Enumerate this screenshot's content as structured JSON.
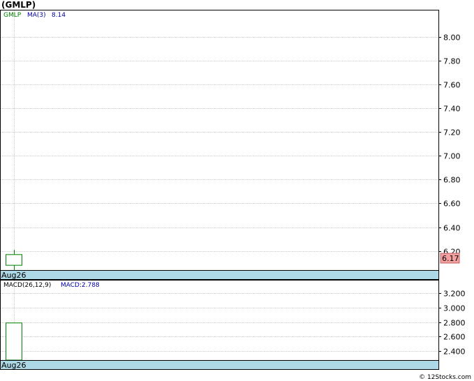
{
  "title": "(GMLP)",
  "price_legend": {
    "symbol": "GMLP",
    "ma_label": "MA(3)",
    "ma_value": "8.14"
  },
  "macd_legend": {
    "label": "MACD(26,12,9)",
    "value_label": "MACD:2.788"
  },
  "current_price_label": "6.17",
  "watermark": "© 12Stocks.com",
  "colors": {
    "symbol_text": "#008000",
    "ma_text": "#0000aa",
    "macd_value_text": "#0000aa",
    "date_band": "#add8e6",
    "candle_border": "#008000",
    "price_tag_bg": "#f4a0a0",
    "grid": "#c8c8c8"
  },
  "chart_data": [
    {
      "type": "candlestick",
      "panel": "price",
      "x": [
        "Aug26"
      ],
      "x_tick_labels": [
        "Aug26"
      ],
      "open": [
        6.08
      ],
      "close": [
        6.17
      ],
      "high": [
        6.21
      ],
      "low": [
        6.04
      ],
      "ylim": [
        6.04,
        8.22
      ],
      "y_ticks": [
        6.2,
        6.4,
        6.6,
        6.8,
        7.0,
        7.2,
        7.4,
        7.6,
        7.8,
        8.0
      ],
      "y_tick_labels": [
        "6.20",
        "6.40",
        "6.60",
        "6.80",
        "7.00",
        "7.20",
        "7.40",
        "7.60",
        "7.80",
        "8.00"
      ],
      "last_value": 6.17,
      "grid": true
    },
    {
      "type": "bar",
      "panel": "macd",
      "categories": [
        "Aug26"
      ],
      "x_tick_labels": [
        "Aug26"
      ],
      "values": [
        2.788
      ],
      "ylim": [
        2.27,
        3.38
      ],
      "y_ticks": [
        2.4,
        2.6,
        2.8,
        3.0,
        3.2
      ],
      "y_tick_labels": [
        "2.400",
        "2.600",
        "2.800",
        "3.000",
        "3.200"
      ],
      "grid": true
    }
  ]
}
